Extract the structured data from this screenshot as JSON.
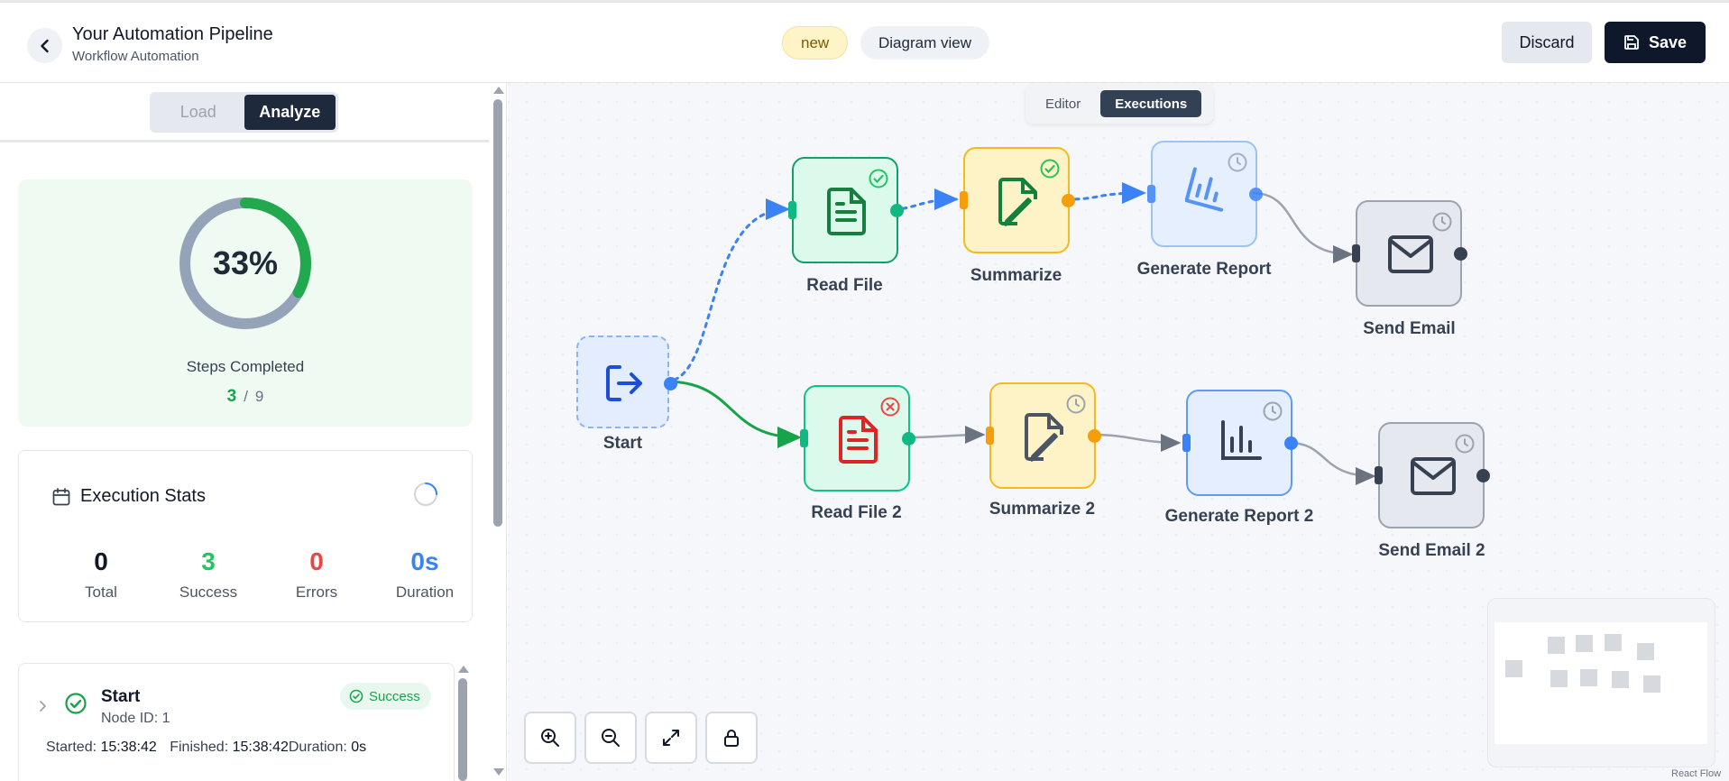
{
  "header": {
    "title": "Your Automation Pipeline",
    "subtitle": "Workflow Automation",
    "badge": "new",
    "view_button": "Diagram view",
    "discard_label": "Discard",
    "save_label": "Save"
  },
  "left_panel": {
    "tabs": [
      {
        "label": "Load",
        "active": false
      },
      {
        "label": "Analyze",
        "active": true
      }
    ],
    "progress": {
      "percent_label": "33%",
      "percent_value": 0.33,
      "caption": "Steps Completed",
      "completed": "3",
      "separator": "/",
      "total": "9"
    },
    "stats": {
      "title": "Execution Stats",
      "items": [
        {
          "value": "0",
          "label": "Total",
          "color": "#111827"
        },
        {
          "value": "3",
          "label": "Success",
          "color": "#22c55e"
        },
        {
          "value": "0",
          "label": "Errors",
          "color": "#ef4444"
        },
        {
          "value": "0s",
          "label": "Duration",
          "color": "#3b82f6"
        }
      ]
    },
    "execution": {
      "name": "Start",
      "node_id": "Node ID: 1",
      "status": "Success",
      "started_label": "Started:",
      "started": "15:38:42",
      "finished_label": "Finished:",
      "finished": "15:38:42",
      "duration_label": "Duration:",
      "duration": "0s"
    }
  },
  "canvas": {
    "modes": [
      {
        "label": "Editor",
        "active": false
      },
      {
        "label": "Executions",
        "active": true
      }
    ],
    "nodes": [
      {
        "id": "start",
        "label": "Start",
        "icon": "sign-out-icon",
        "status": "running"
      },
      {
        "id": "read-file",
        "label": "Read File",
        "icon": "document-icon",
        "status": "success"
      },
      {
        "id": "summarize",
        "label": "Summarize",
        "icon": "file-edit-icon",
        "status": "success"
      },
      {
        "id": "generate-report",
        "label": "Generate Report",
        "icon": "chart-icon",
        "status": "pending"
      },
      {
        "id": "send-email",
        "label": "Send Email",
        "icon": "mail-icon",
        "status": "pending"
      },
      {
        "id": "read-file-2",
        "label": "Read File 2",
        "icon": "document-icon",
        "status": "error"
      },
      {
        "id": "summarize-2",
        "label": "Summarize 2",
        "icon": "file-edit-icon",
        "status": "pending"
      },
      {
        "id": "generate-report-2",
        "label": "Generate Report 2",
        "icon": "chart-icon",
        "status": "pending"
      },
      {
        "id": "send-email-2",
        "label": "Send Email 2",
        "icon": "mail-icon",
        "status": "pending"
      }
    ],
    "attribution": "React Flow"
  },
  "colors": {
    "success": "#22c55e",
    "error": "#ef4444",
    "accent": "#3b82f6",
    "warning": "#f59e0b",
    "dark": "#0f172a"
  }
}
